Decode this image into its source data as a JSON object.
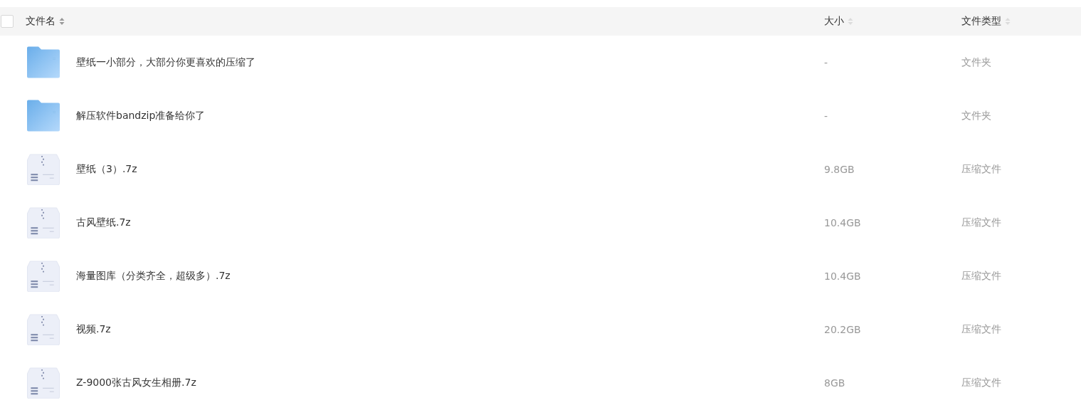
{
  "header": {
    "checked": false,
    "columns": [
      {
        "label": "文件名",
        "sort_active": true
      },
      {
        "label": "大小",
        "sort_active": false
      },
      {
        "label": "文件类型",
        "sort_active": false
      }
    ]
  },
  "rows": [
    {
      "kind": "folder",
      "name": "壁纸一小部分，大部分你更喜欢的压缩了",
      "size": "-",
      "type": "文件夹"
    },
    {
      "kind": "folder",
      "name": "解压软件bandzip准备给你了",
      "size": "-",
      "type": "文件夹"
    },
    {
      "kind": "archive",
      "name": "壁纸（3）.7z",
      "size": "9.8GB",
      "type": "压缩文件"
    },
    {
      "kind": "archive",
      "name": "古风壁纸.7z",
      "size": "10.4GB",
      "type": "压缩文件"
    },
    {
      "kind": "archive",
      "name": "海量图库（分类齐全，超级多）.7z",
      "size": "10.4GB",
      "type": "压缩文件"
    },
    {
      "kind": "archive",
      "name": "视频.7z",
      "size": "20.2GB",
      "type": "压缩文件"
    },
    {
      "kind": "archive",
      "name": "Z-9000张古风女生相册.7z",
      "size": "8GB",
      "type": "压缩文件"
    }
  ]
}
